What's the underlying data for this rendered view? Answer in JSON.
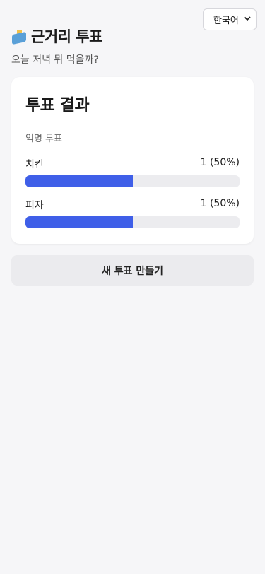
{
  "language_select": {
    "value": "한국어",
    "icon": "chevron-down-icon"
  },
  "header": {
    "icon": "ballot-box-icon",
    "title": "근거리 투표",
    "subtitle": "오늘 저녁 뭐 먹을까?"
  },
  "results": {
    "title": "투표 결과",
    "mode_label": "익명 투표",
    "options": [
      {
        "label": "치킨",
        "count_text": "1 (50%)",
        "fraction": 0.5
      },
      {
        "label": "피자",
        "count_text": "1 (50%)",
        "fraction": 0.5
      }
    ],
    "bar_color": "#3f5fe8"
  },
  "actions": {
    "new_poll_label": "새 투표 만들기"
  }
}
